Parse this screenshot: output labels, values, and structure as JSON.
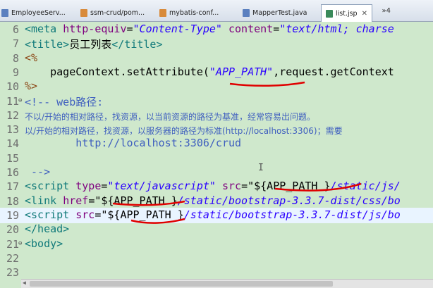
{
  "tabs": [
    {
      "label": "EmployeeServ...",
      "icon": "java-file-icon"
    },
    {
      "label": "ssm-crud/pom...",
      "icon": "xml-file-icon"
    },
    {
      "label": "mybatis-conf...",
      "icon": "xml-file-icon"
    },
    {
      "label": "MapperTest.java",
      "icon": "java-file-icon"
    },
    {
      "label": "list.jsp",
      "icon": "jsp-file-icon",
      "active": true
    }
  ],
  "tab_close": "✕",
  "overflow_tabs": "»4",
  "colors": {
    "editor_bg": "#cfe8cc",
    "tag": "#117a7a",
    "attr": "#7f007f",
    "string": "#2a00ff",
    "comment": "#3f5fbf",
    "annotation_red": "#e00000"
  },
  "editor": {
    "lines": [
      {
        "n": "6",
        "seg": [
          [
            "tag",
            "<meta "
          ],
          [
            "attr",
            "http-equiv"
          ],
          [
            "plain",
            "="
          ],
          [
            "str",
            "\"Content-Type\""
          ],
          [
            "plain",
            " "
          ],
          [
            "attr",
            "content"
          ],
          [
            "plain",
            "="
          ],
          [
            "str",
            "\"text/html; charse"
          ]
        ]
      },
      {
        "n": "7",
        "seg": [
          [
            "tag",
            "<title>"
          ],
          [
            "plain",
            "员工列表"
          ],
          [
            "tag",
            "</title>"
          ]
        ]
      },
      {
        "n": "8",
        "seg": [
          [
            "jsp",
            "<%"
          ]
        ]
      },
      {
        "n": "9",
        "seg": [
          [
            "plain",
            "    pageContext.setAttribute("
          ],
          [
            "str",
            "\"APP_PATH\""
          ],
          [
            "plain",
            ",request.getContext"
          ]
        ]
      },
      {
        "n": "10",
        "seg": [
          [
            "jsp",
            "%>"
          ]
        ]
      },
      {
        "n": "11",
        "fold": true,
        "seg": [
          [
            "cmt",
            "<!-- web路径:"
          ]
        ]
      },
      {
        "n": "12",
        "small": true,
        "seg": [
          [
            "cmt",
            "不以/开始的相对路径，找资源，以当前资源的路径为基准，经常容易出问题。"
          ]
        ]
      },
      {
        "n": "13",
        "small": true,
        "seg": [
          [
            "cmt",
            "以/开始的相对路径，找资源，以服务器的路径为标准(http://localhost:3306)；需要"
          ]
        ]
      },
      {
        "n": "14",
        "seg": [
          [
            "cmt",
            "        http://localhost:3306/crud"
          ]
        ]
      },
      {
        "n": "15",
        "seg": [
          [
            "plain",
            ""
          ]
        ]
      },
      {
        "n": "16",
        "seg": [
          [
            "cmt",
            " -->"
          ]
        ]
      },
      {
        "n": "17",
        "seg": [
          [
            "tag",
            "<script "
          ],
          [
            "attr",
            "type"
          ],
          [
            "plain",
            "="
          ],
          [
            "str",
            "\"text/javascript\""
          ],
          [
            "plain",
            " "
          ],
          [
            "attr",
            "src"
          ],
          [
            "plain",
            "="
          ],
          [
            "plain",
            "\"${APP_PATH }"
          ],
          [
            "str",
            "/static/js/"
          ]
        ]
      },
      {
        "n": "18",
        "seg": [
          [
            "tag",
            "<link "
          ],
          [
            "attr",
            "href"
          ],
          [
            "plain",
            "="
          ],
          [
            "plain",
            "\"${APP_PATH }"
          ],
          [
            "str",
            "/static/bootstrap-3.3.7-dist/css/bo"
          ]
        ]
      },
      {
        "n": "19",
        "cur": true,
        "seg": [
          [
            "tag",
            "<script "
          ],
          [
            "attr",
            "src"
          ],
          [
            "plain",
            "="
          ],
          [
            "plain",
            "\"${APP_PATH }"
          ],
          [
            "str",
            "/static/bootstrap-3.3.7-dist/js/bo"
          ]
        ]
      },
      {
        "n": "20",
        "seg": [
          [
            "tag",
            "</head>"
          ]
        ]
      },
      {
        "n": "21",
        "fold": true,
        "seg": [
          [
            "tag",
            "<body>"
          ]
        ]
      },
      {
        "n": "22",
        "seg": [
          [
            "plain",
            ""
          ]
        ]
      },
      {
        "n": "23",
        "seg": [
          [
            "plain",
            ""
          ]
        ]
      }
    ]
  }
}
